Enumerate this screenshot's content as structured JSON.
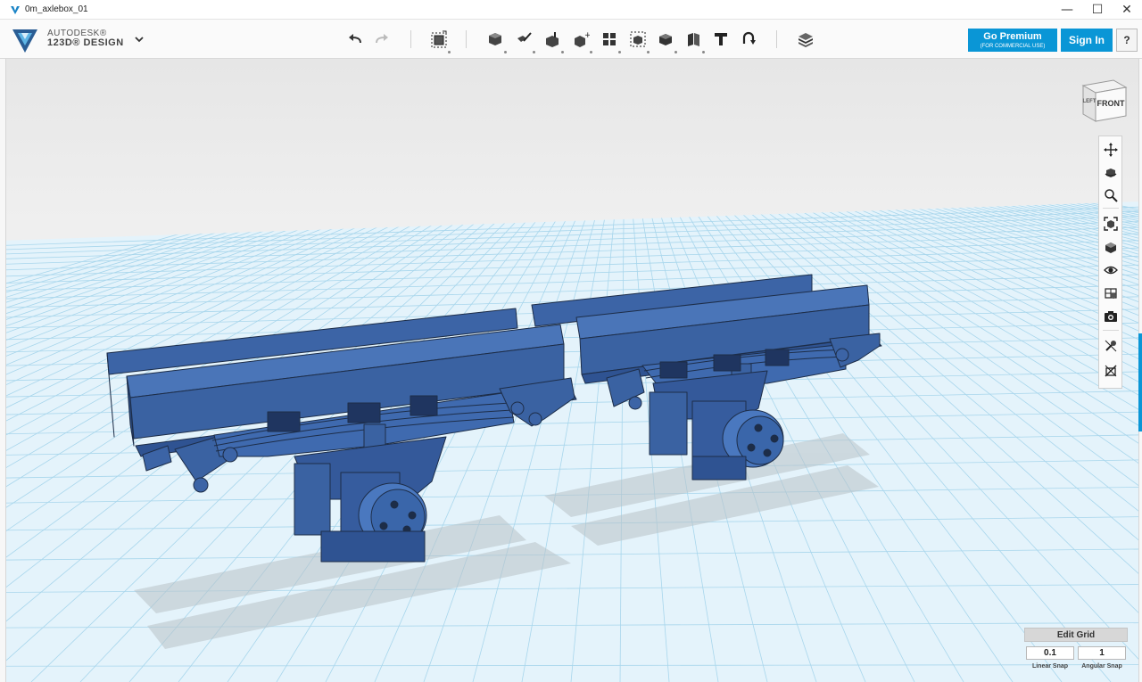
{
  "window": {
    "title": "0m_axlebox_01",
    "minimize_glyph": "—",
    "maximize_glyph": "☐",
    "close_glyph": "✕"
  },
  "brand": {
    "line1": "AUTODESK®",
    "line2": "123D® DESIGN"
  },
  "toolbar": {
    "icons": [
      "undo-icon",
      "redo-icon",
      "transform-icon",
      "primitives-icon",
      "sketch-icon",
      "construct-icon",
      "modify-icon",
      "pattern-icon",
      "grouping-icon",
      "combine-icon",
      "measure-icon",
      "text-icon",
      "snap-icon",
      "material-icon"
    ]
  },
  "account": {
    "premium_label": "Go Premium",
    "premium_sub": "(FOR COMMERCIAL USE)",
    "signin_label": "Sign In",
    "help_label": "?"
  },
  "viewcube": {
    "front_label": "FRONT",
    "left_label": "LEFT"
  },
  "navbar": {
    "icons": [
      "pan-icon",
      "orbit-icon",
      "zoom-icon",
      "fit-icon",
      "view-mode-icon",
      "visibility-icon",
      "materials-visibility-icon",
      "screenshot-icon",
      "snap-on-icon",
      "snap-off-icon"
    ]
  },
  "grid": {
    "title": "Edit Grid",
    "linear_value": "0.1",
    "angular_value": "1",
    "linear_label": "Linear Snap",
    "angular_label": "Angular Snap"
  },
  "colors": {
    "accent": "#0a96d6",
    "model_blue": "#3a5f9f",
    "grid_line": "#a8d6ec",
    "grid_floor": "#e2f2fa"
  }
}
